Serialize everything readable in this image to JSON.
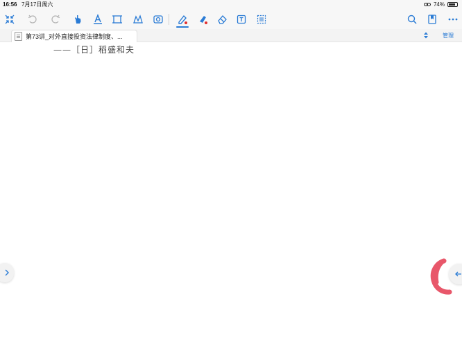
{
  "status_bar": {
    "time": "16:56",
    "date": "7月17日周六",
    "battery": "74%"
  },
  "toolbar": {
    "icons": [
      "collapse-icon",
      "undo-icon",
      "redo-icon",
      "hand-icon",
      "text-tool-icon",
      "rectangle-select-icon",
      "lasso-icon",
      "image-tool-icon",
      "pen-icon",
      "highlighter-icon",
      "eraser-icon",
      "textbox-icon",
      "select-box-icon",
      "search-icon",
      "bookmark-icon",
      "more-icon"
    ],
    "active_tool": "pen",
    "accent_color": "#2a7bd5",
    "pen_color": "#e03030"
  },
  "document": {
    "tab_title": "第73讲_对外直接投资法律制度、...",
    "manage_label": "管理"
  },
  "content": {
    "author_line": "——［日］稻盛和夫"
  },
  "annotation": {
    "color": "#e8576a"
  }
}
